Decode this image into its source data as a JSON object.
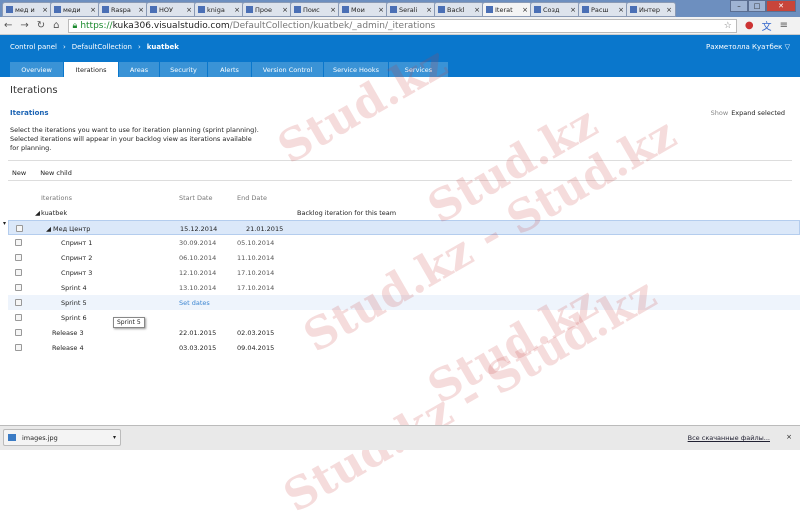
{
  "browser": {
    "tabs": [
      {
        "label": "мед и"
      },
      {
        "label": "меди"
      },
      {
        "label": "Raspa"
      },
      {
        "label": "НОУ"
      },
      {
        "label": "kniga"
      },
      {
        "label": "Прое"
      },
      {
        "label": "Поис"
      },
      {
        "label": "Мои"
      },
      {
        "label": "Serali"
      },
      {
        "label": "Backl"
      },
      {
        "label": "Iterat",
        "active": true
      },
      {
        "label": "Созд"
      },
      {
        "label": "Расш"
      },
      {
        "label": "Интер"
      }
    ],
    "url_scheme": "https://",
    "url_host": "kuka306.visualstudio.com",
    "url_path": "/DefaultCollection/kuatbek/_admin/_iterations"
  },
  "header": {
    "breadcrumb": [
      "Control panel",
      "DefaultCollection",
      "kuatbek"
    ],
    "user": "Рахметолла Куатбек ▽",
    "tabs": [
      {
        "label": "Overview",
        "w": 53
      },
      {
        "label": "Iterations",
        "w": 54,
        "active": true
      },
      {
        "label": "Areas",
        "w": 40
      },
      {
        "label": "Security",
        "w": 47
      },
      {
        "label": "Alerts",
        "w": 43
      },
      {
        "label": "Version Control",
        "w": 71
      },
      {
        "label": "Service Hooks",
        "w": 64
      },
      {
        "label": "Services",
        "w": 59
      }
    ]
  },
  "page": {
    "title": "Iterations",
    "section": "Iterations",
    "description": "Select the iterations you want to use for iteration planning (sprint planning). Selected iterations will appear in your backlog view as iterations available for planning.",
    "show_label": "Show",
    "expand_selected": "Expand selected",
    "new": "New",
    "new_child": "New child"
  },
  "grid": {
    "columns": [
      "Iterations",
      "Start Date",
      "End Date"
    ],
    "root": "kuatbek",
    "root_note": "Backlog iteration for this team",
    "rows": [
      {
        "name": "Мед Центр",
        "start": "15.12.2014",
        "end": "21.01.2015",
        "level": 1,
        "expanded": true,
        "selected": true
      },
      {
        "name": "Спринт 1",
        "start": "30.09.2014",
        "end": "05.10.2014",
        "level": 2
      },
      {
        "name": "Спринт 2",
        "start": "06.10.2014",
        "end": "11.10.2014",
        "level": 2
      },
      {
        "name": "Спринт 3",
        "start": "12.10.2014",
        "end": "17.10.2014",
        "level": 2
      },
      {
        "name": "Sprint 4",
        "start": "13.10.2014",
        "end": "17.10.2014",
        "level": 2
      },
      {
        "name": "Sprint 5",
        "start": "Set dates",
        "end": "",
        "level": 2,
        "hover": true
      },
      {
        "name": "Sprint 6",
        "start": "",
        "end": "",
        "level": 2
      },
      {
        "name": "Release 3",
        "start": "22.01.2015",
        "end": "02.03.2015",
        "level": 1
      },
      {
        "name": "Release 4",
        "start": "03.03.2015",
        "end": "09.04.2015",
        "level": 1
      }
    ]
  },
  "tooltip": "Sprint 5",
  "downloads": {
    "file": "images.jpg",
    "all": "Все скачанные файлы..."
  }
}
